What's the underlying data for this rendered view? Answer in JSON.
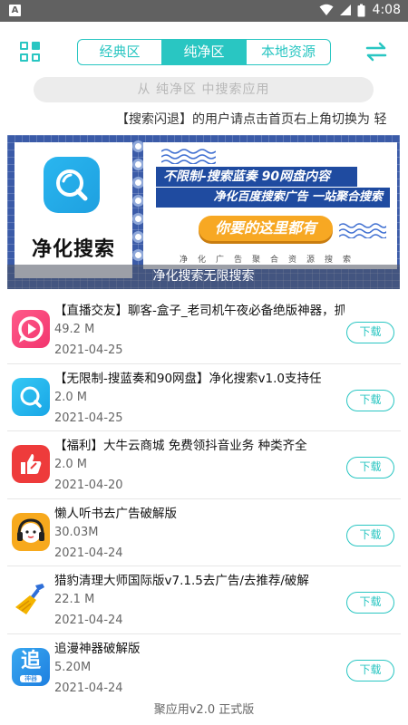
{
  "status_bar": {
    "app_badge": "A",
    "time": "4:08"
  },
  "tabs": [
    {
      "label": "经典区",
      "active": false
    },
    {
      "label": "纯净区",
      "active": true
    },
    {
      "label": "本地资源",
      "active": false
    }
  ],
  "search": {
    "placeholder": "从 纯净区 中搜索应用"
  },
  "marquee": "【搜索闪退】的用户请点击首页右上角切换为 轻",
  "banner": {
    "brand": "净化搜索",
    "headline1": "不限制-搜索蓝奏 90网盘内容",
    "headline2": "净化百度搜索广告 一站聚合搜索",
    "pill": "你要的这里都有",
    "small_text": "净化广告聚合资源搜索",
    "caption": "净化搜索无限搜索"
  },
  "apps": [
    {
      "name": "【直播交友】聊客-盒子_老司机午夜必备绝版神器，抓",
      "size": "49.2 M",
      "date": "2021-04-25",
      "button": "下载",
      "icon": "live-chat-app-icon"
    },
    {
      "name": "【无限制-搜蓝奏和90网盘】净化搜索v1.0支持任",
      "size": "2.0 M",
      "date": "2021-04-25",
      "button": "下载",
      "icon": "search-app-icon"
    },
    {
      "name": "【福利】大牛云商城 免费领抖音业务 种类齐全",
      "size": "2.0 M",
      "date": "2021-04-20",
      "button": "下载",
      "icon": "thumbs-up-app-icon"
    },
    {
      "name": "懒人听书去广告破解版",
      "size": "30.03M",
      "date": "2021-04-24",
      "button": "下载",
      "icon": "headphones-app-icon"
    },
    {
      "name": "猎豹清理大师国际版v7.1.5去广告/去推荐/破解",
      "size": "22.1 M",
      "date": "2021-04-24",
      "button": "下载",
      "icon": "broom-app-icon"
    },
    {
      "name": "追漫神器破解版",
      "size": "5.20M",
      "date": "2021-04-24",
      "button": "下载",
      "icon": "comic-app-icon",
      "icon_text": "追",
      "icon_subtext": "神器"
    }
  ],
  "footer": "聚应用v2.0 正式版",
  "colors": {
    "accent": "#29c6c2",
    "banner_blue": "#3b5ba8",
    "pill": "#f7a823"
  }
}
